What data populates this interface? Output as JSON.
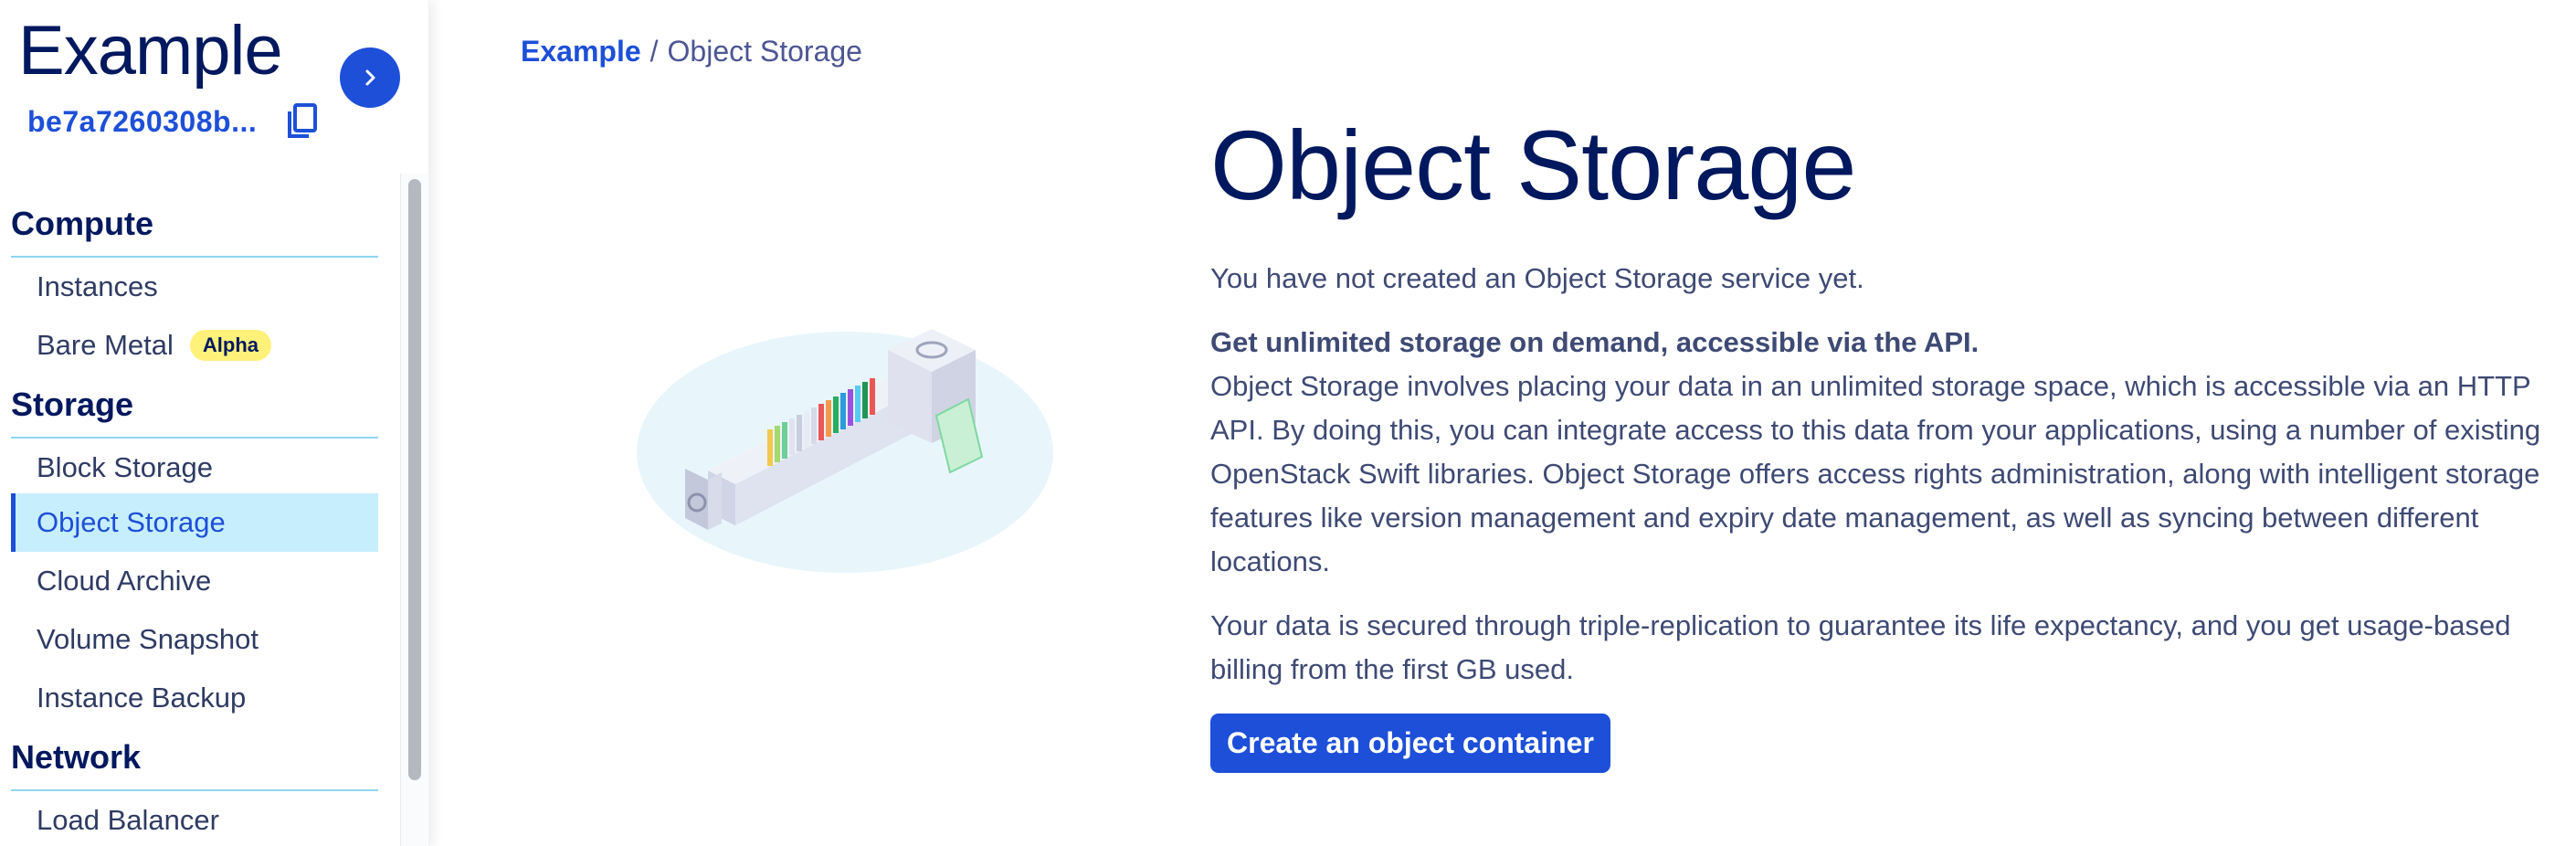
{
  "sidebar": {
    "project_name": "Example",
    "project_id": "be7a7260308b...",
    "groups": [
      {
        "title": "Compute",
        "items": [
          {
            "label": "Instances"
          },
          {
            "label": "Bare Metal",
            "badge": "Alpha"
          }
        ]
      },
      {
        "title": "Storage",
        "items": [
          {
            "label": "Block Storage"
          },
          {
            "label": "Object Storage",
            "active": true
          },
          {
            "label": "Cloud Archive"
          },
          {
            "label": "Volume Snapshot"
          },
          {
            "label": "Instance Backup"
          }
        ]
      },
      {
        "title": "Network",
        "items": [
          {
            "label": "Load Balancer"
          }
        ]
      }
    ],
    "icons": {
      "toggle": "chevron-right-icon",
      "copy": "copy-icon"
    }
  },
  "breadcrumb": {
    "home": "Example",
    "separator": "/",
    "current": "Object Storage"
  },
  "main": {
    "title": "Object Storage",
    "empty_text": "You have not created an Object Storage service yet.",
    "headline": "Get unlimited storage on demand, accessible via the API.",
    "description": "Object Storage involves placing your data in an unlimited storage space, which is accessible via an HTTP API. By doing this, you can integrate access to this data from your applications, using a number of existing OpenStack Swift libraries. Object Storage offers access rights administration, along with intelligent storage features like version management and expiry date management, as well as syncing between different locations.",
    "security_text": "Your data is secured through triple-replication to guarantee its life expectancy, and you get usage-based billing from the first GB used.",
    "create_button": "Create an object container"
  },
  "colors": {
    "primary": "#1d4fd8",
    "heading": "#00185e",
    "text": "#3e4a74",
    "active_bg": "#c7eefd",
    "divider": "#8fd5f0",
    "badge_bg": "#fff17a"
  }
}
